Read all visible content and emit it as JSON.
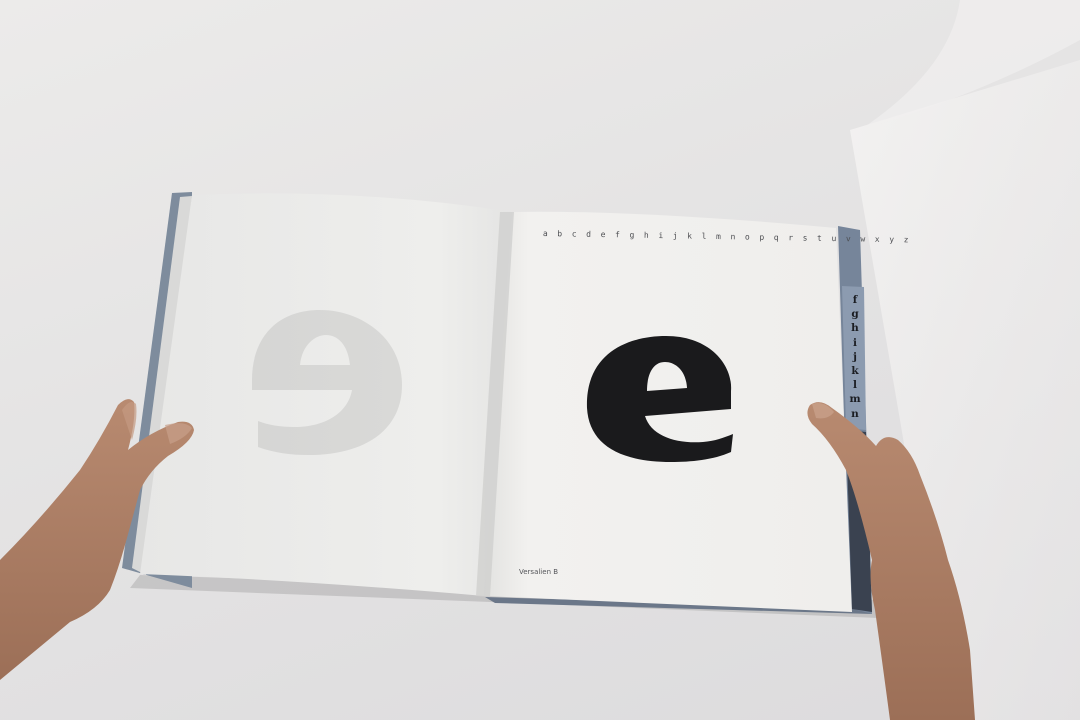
{
  "scene": {
    "subject": "open-alphabet-book",
    "background_color": "#e6e5e5",
    "page_color": "#f1f0ee",
    "cover_color": "#7f8ea0",
    "ink_color": "#1a1a1c"
  },
  "book": {
    "alphabet_header": "a b c d e f g h i j k l m n o p q r s t u v w x y z",
    "footer_label": "Versalien B",
    "tab_letters": [
      "f",
      "g",
      "h",
      "i",
      "j",
      "k",
      "l",
      "m",
      "n"
    ]
  }
}
